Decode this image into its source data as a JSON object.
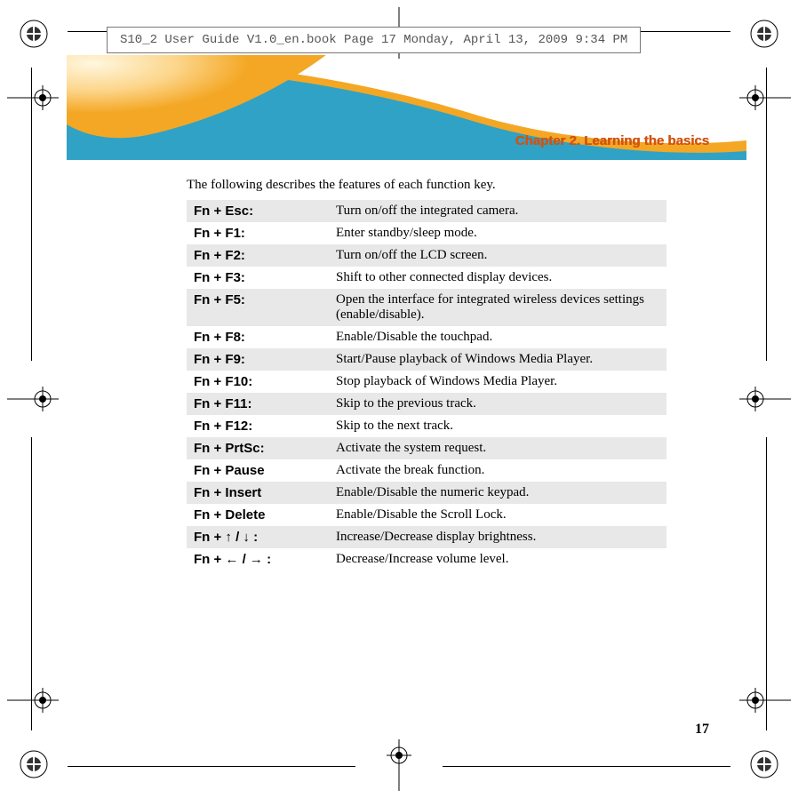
{
  "file_header": "S10_2 User Guide V1.0_en.book  Page 17  Monday, April 13, 2009  9:34 PM",
  "chapter_title": "Chapter 2. Learning the basics",
  "intro": "The following describes the features of each function key.",
  "fn_table": [
    {
      "key": "Fn + Esc:",
      "desc": "Turn on/off the integrated camera."
    },
    {
      "key": "Fn + F1:",
      "desc": "Enter standby/sleep mode."
    },
    {
      "key": "Fn + F2:",
      "desc": "Turn on/off the LCD screen."
    },
    {
      "key": "Fn + F3:",
      "desc": "Shift to other connected display devices."
    },
    {
      "key": "Fn + F5:",
      "desc": "Open the interface for integrated wireless devices settings (enable/disable)."
    },
    {
      "key": "Fn + F8:",
      "desc": "Enable/Disable the touchpad."
    },
    {
      "key": "Fn + F9:",
      "desc": "Start/Pause playback of Windows Media Player."
    },
    {
      "key": "Fn + F10:",
      "desc": "Stop playback of Windows Media Player."
    },
    {
      "key": "Fn + F11:",
      "desc": "Skip to the previous track."
    },
    {
      "key": "Fn + F12:",
      "desc": "Skip to the next track."
    },
    {
      "key": "Fn + PrtSc:",
      "desc": "Activate the system request."
    },
    {
      "key": "Fn + Pause",
      "desc": "Activate the break function."
    },
    {
      "key": "Fn + Insert",
      "desc": "Enable/Disable the numeric keypad."
    },
    {
      "key": "Fn + Delete",
      "desc": "Enable/Disable the Scroll Lock."
    },
    {
      "key": "Fn + ↑ / ↓ :",
      "desc": "Increase/Decrease display brightness."
    },
    {
      "key": "Fn + ← / → :",
      "desc": "Decrease/Increase volume level."
    }
  ],
  "page_number": "17"
}
